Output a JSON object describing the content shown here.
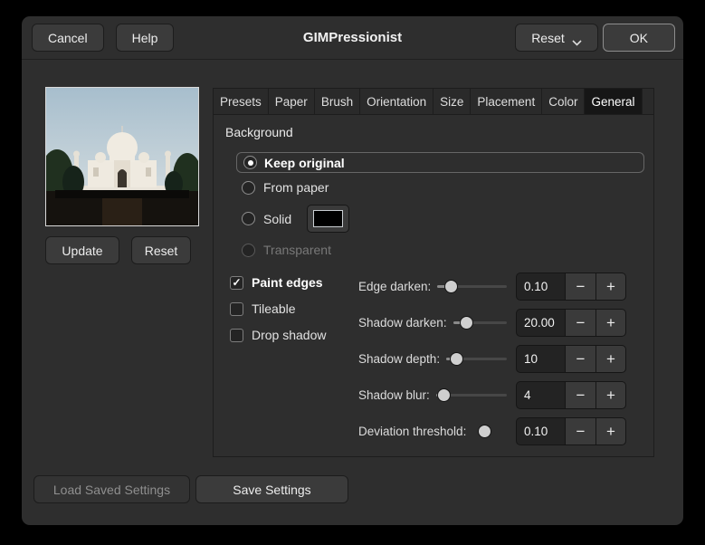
{
  "window": {
    "title": "GIMPressionist"
  },
  "header": {
    "cancel": "Cancel",
    "help": "Help",
    "reset": "Reset",
    "ok": "OK"
  },
  "preview": {
    "update": "Update",
    "reset": "Reset"
  },
  "tabs": [
    "Presets",
    "Paper",
    "Brush",
    "Orientation",
    "Size",
    "Placement",
    "Color",
    "General"
  ],
  "active_tab": "General",
  "panel": {
    "section_title": "Background",
    "options": [
      {
        "label": "Keep original",
        "selected": true
      },
      {
        "label": "From paper",
        "selected": false
      },
      {
        "label": "Solid",
        "selected": false
      },
      {
        "label": "Transparent",
        "selected": false,
        "disabled": true
      }
    ],
    "solid_color": "#000000",
    "checkboxes": [
      {
        "label": "Paint edges",
        "checked": true
      },
      {
        "label": "Tileable",
        "checked": false
      },
      {
        "label": "Drop shadow",
        "checked": false
      }
    ],
    "sliders": [
      {
        "label": "Edge darken:",
        "value": "0.10",
        "fraction": 0.14
      },
      {
        "label": "Shadow darken:",
        "value": "20.00",
        "fraction": 0.2
      },
      {
        "label": "Shadow depth:",
        "value": "10",
        "fraction": 0.1
      },
      {
        "label": "Shadow blur:",
        "value": "4",
        "fraction": 0.05
      },
      {
        "label": "Deviation threshold:",
        "value": "0.10",
        "fraction": 0.3
      }
    ]
  },
  "footer": {
    "load": "Load Saved Settings",
    "save": "Save Settings"
  },
  "icons": {
    "check": "✓",
    "minus": "−",
    "plus": "+"
  }
}
